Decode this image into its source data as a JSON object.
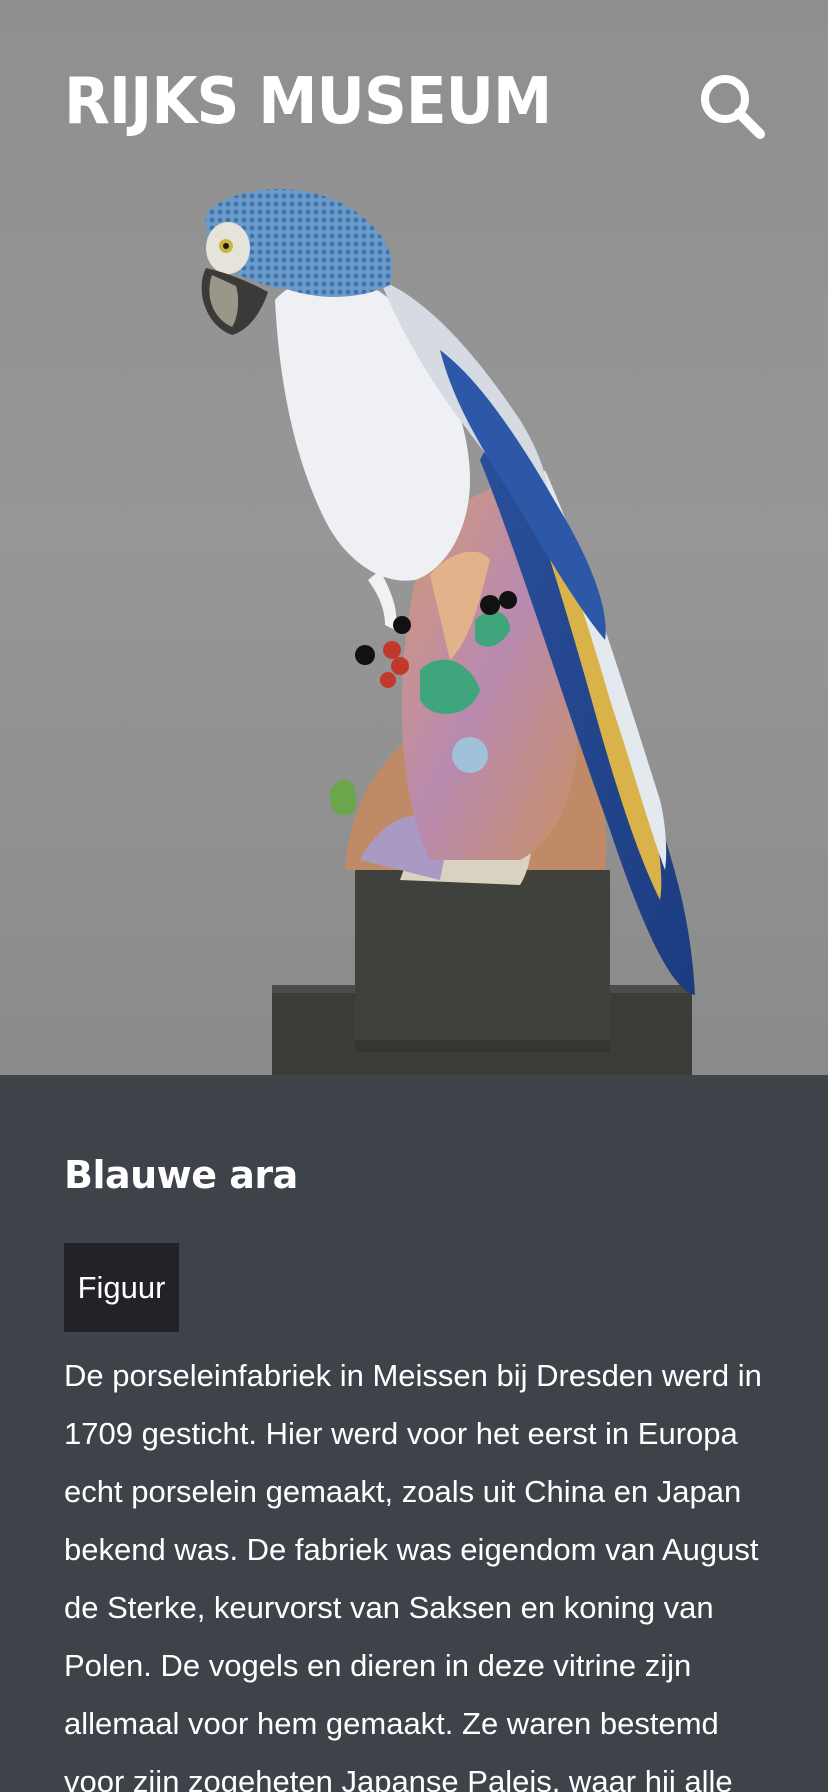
{
  "header": {
    "logo_text": "RIJKS MUSEUM",
    "search_icon": "search-icon"
  },
  "artwork": {
    "subject": "porcelain blue macaw figure on pedestal"
  },
  "object": {
    "title": "Blauwe ara",
    "category": "Figuur",
    "description": "De porseleinfabriek in Meissen bij Dresden werd in 1709 gesticht. Hier werd voor het eerst in Europa echt porselein gemaakt, zoals uit China en Japan bekend was. De fabriek was eigendom van August de Sterke, keurvorst van Saksen en koning van Polen. De vogels en dieren in deze vitrine zijn allemaal voor hem gemaakt. Ze waren bestemd voor zijn zogeheten Japanse Paleis, waar hij alle wanden wilde vullen"
  },
  "colors": {
    "hero_background": "#919191",
    "info_background": "#3e434a",
    "tag_background": "#212326",
    "text": "#ffffff"
  }
}
